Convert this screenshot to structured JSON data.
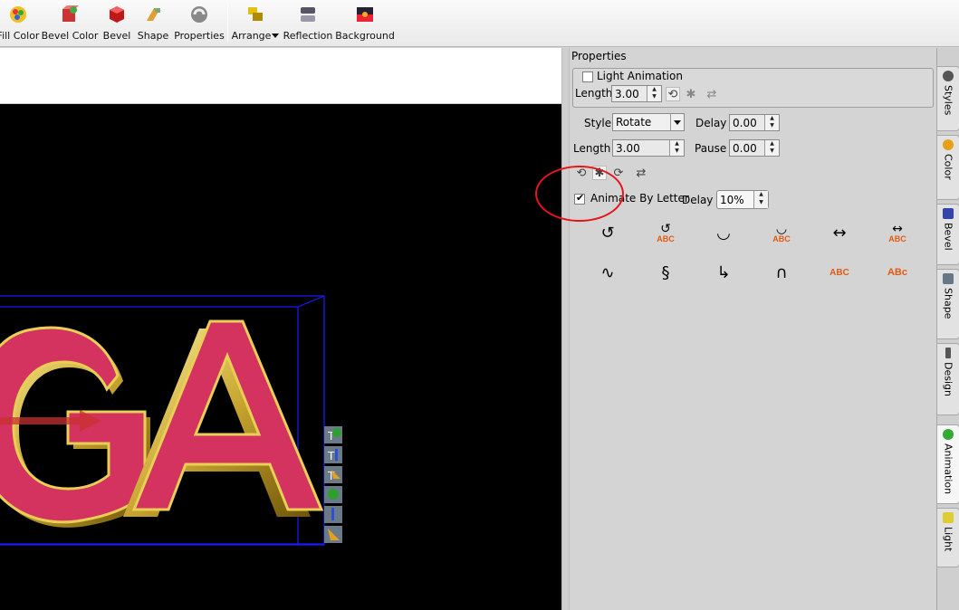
{
  "toolbar": {
    "buttons": [
      {
        "label": "Fill Color",
        "icon": "fill-color-icon"
      },
      {
        "label": "Bevel Color",
        "icon": "bevel-color-icon"
      },
      {
        "label": "Bevel",
        "icon": "bevel-icon"
      },
      {
        "label": "Shape",
        "icon": "shape-icon"
      },
      {
        "label": "Properties",
        "icon": "properties-icon"
      },
      {
        "label": "Arrange",
        "icon": "arrange-icon"
      },
      {
        "label": "Reflection",
        "icon": "reflection-icon"
      },
      {
        "label": "Background",
        "icon": "background-icon"
      }
    ]
  },
  "canvas": {
    "text": "GA",
    "colors": {
      "face": "#d4325f",
      "bevel": "#d6c04a",
      "box": "#1a1aff",
      "background": "#000000"
    }
  },
  "properties": {
    "title": "Properties",
    "light_animation": {
      "label": "Light Animation",
      "checked": false,
      "length_label": "Length",
      "length_value": "3.00"
    },
    "style_label": "Style",
    "style_value": "Rotate",
    "delay_label": "Delay",
    "delay_value": "0.00",
    "length_label": "Length",
    "length_value": "3.00",
    "pause_label": "Pause",
    "pause_value": "0.00",
    "animate_by_letter": {
      "label": "Animate By Letter",
      "checked": true,
      "delay_label": "Delay",
      "delay_value": "10%"
    },
    "abc_text": "ABC",
    "abc_small_text": "ABc"
  },
  "tabs": [
    {
      "label": "Styles",
      "icon": "styles-icon",
      "color": "#555555"
    },
    {
      "label": "Color",
      "icon": "color-palette-icon",
      "color": "#e8a018"
    },
    {
      "label": "Bevel",
      "icon": "bevel-tab-icon",
      "color": "#3344aa"
    },
    {
      "label": "Shape",
      "icon": "shape-tab-icon",
      "color": "#667788"
    },
    {
      "label": "Design",
      "icon": "design-icon",
      "color": "#555555"
    },
    {
      "label": "Animation",
      "icon": "animation-icon",
      "color": "#33aa33",
      "active": true
    },
    {
      "label": "Light",
      "icon": "light-icon",
      "color": "#ddcc33"
    }
  ]
}
